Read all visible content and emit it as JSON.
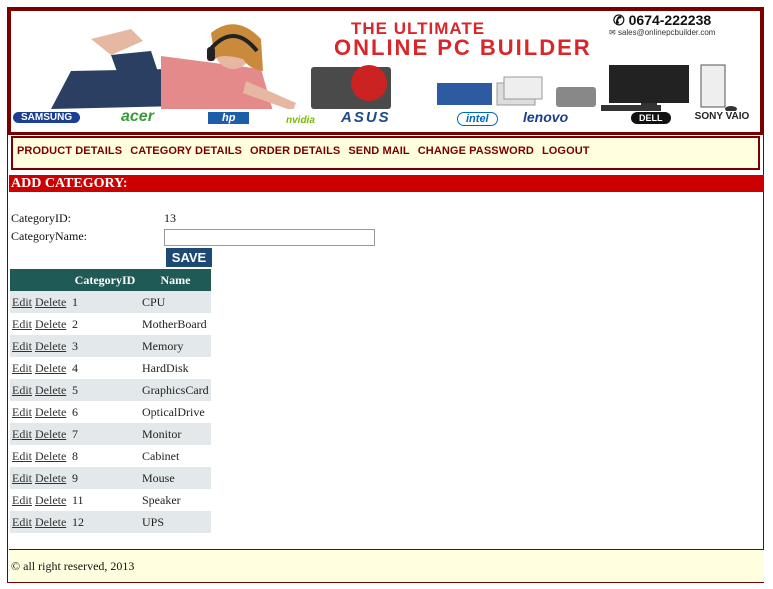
{
  "banner": {
    "title_line1": "THE ULTIMATE",
    "title_line2": "ONLINE PC BUILDER",
    "phone": "0674-222238",
    "email": "sales@onlinepcbuilder.com",
    "brands": [
      "SAMSUNG",
      "acer",
      "hp",
      "nvidia",
      "ASUS",
      "intel",
      "lenovo",
      "DELL",
      "SONY VAIO"
    ]
  },
  "nav": {
    "items": [
      "PRODUCT DETAILS",
      "CATEGORY DETAILS",
      "ORDER DETAILS",
      "SEND MAIL",
      "CHANGE PASSWORD",
      "LOGOUT"
    ]
  },
  "section": {
    "title": "ADD CATEGORY:"
  },
  "form": {
    "id_label": "CategoryID:",
    "id_value": "13",
    "name_label": "CategoryName:",
    "name_value": "",
    "save_label": "SAVE"
  },
  "table": {
    "headers": [
      "",
      "CategoryID",
      "Name"
    ],
    "edit_label": "Edit",
    "delete_label": "Delete",
    "rows": [
      {
        "id": "1",
        "name": "CPU"
      },
      {
        "id": "2",
        "name": "MotherBoard"
      },
      {
        "id": "3",
        "name": "Memory"
      },
      {
        "id": "4",
        "name": "HardDisk"
      },
      {
        "id": "5",
        "name": "GraphicsCard"
      },
      {
        "id": "6",
        "name": "OpticalDrive"
      },
      {
        "id": "7",
        "name": "Monitor"
      },
      {
        "id": "8",
        "name": "Cabinet"
      },
      {
        "id": "9",
        "name": "Mouse"
      },
      {
        "id": "11",
        "name": "Speaker"
      },
      {
        "id": "12",
        "name": "UPS"
      }
    ]
  },
  "footer": {
    "text": "© all right reserved, 2013"
  },
  "colors": {
    "accent_dark": "#7a0000",
    "section_red": "#cc0000",
    "header_teal": "#1f5a56",
    "save_blue": "#1d4a74",
    "cream": "#ffffe0"
  }
}
